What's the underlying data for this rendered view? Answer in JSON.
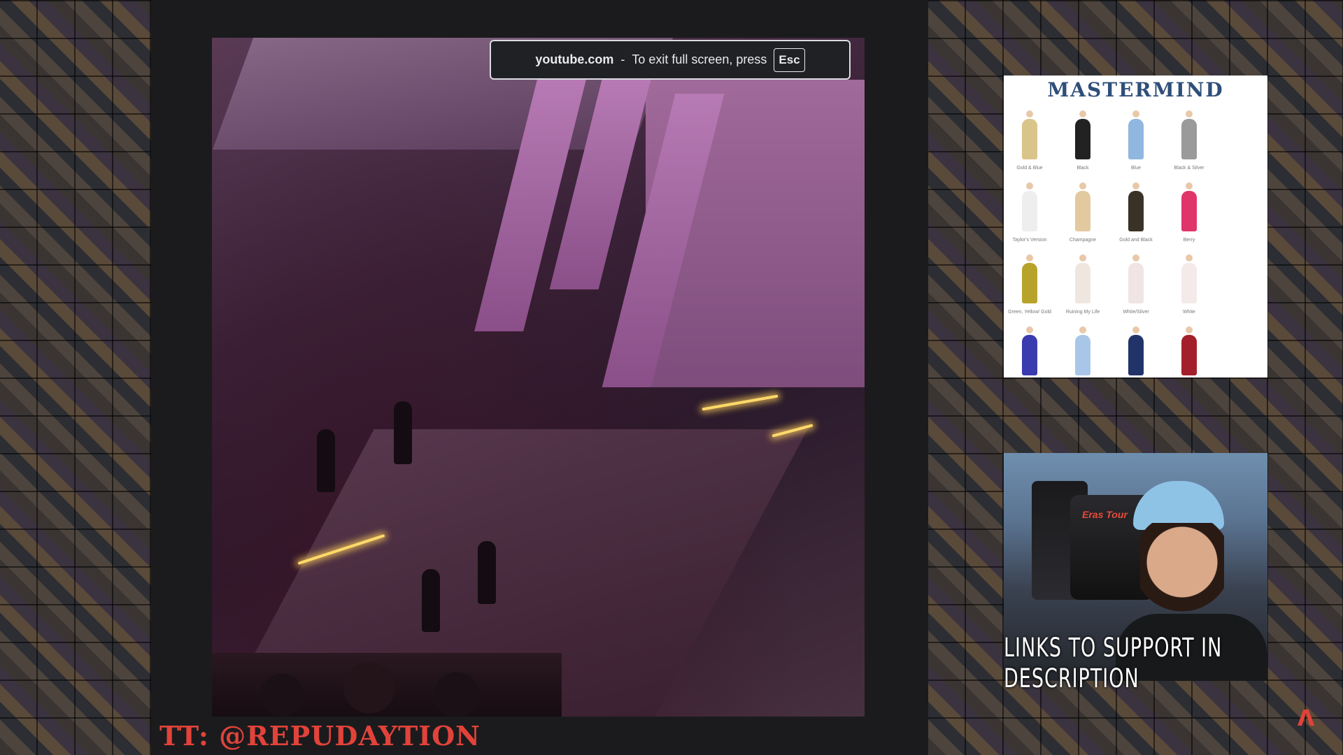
{
  "fullscreen_toast": {
    "domain": "youtube.com",
    "separator": "-",
    "message": "To exit full screen, press",
    "key": "Esc"
  },
  "overlay": {
    "handle": "TT: @REPUDAYTION",
    "support_banner": "LINKS TO SUPPORT IN DESCRIPTION"
  },
  "mastermind": {
    "title": "MASTERMIND",
    "outfits": [
      {
        "label": "Gold & Blue",
        "color": "#d9c48a"
      },
      {
        "label": "Black",
        "color": "#222222"
      },
      {
        "label": "Blue",
        "color": "#8fb7e0"
      },
      {
        "label": "Black & Silver",
        "color": "#9a9a9a"
      },
      {
        "label": "Taylor's Version",
        "color": "#eeeeee"
      },
      {
        "label": "Champagne",
        "color": "#e3c9a0"
      },
      {
        "label": "Gold and Black",
        "color": "#3a3226"
      },
      {
        "label": "Berry",
        "color": "#e0356a"
      },
      {
        "label": "Green, Yellow/ Gold",
        "color": "#b8a32a"
      },
      {
        "label": "Ruining My Life",
        "color": "#f0e6e0"
      },
      {
        "label": "White/Silver",
        "color": "#f1e4e4"
      },
      {
        "label": "White",
        "color": "#f4eaea"
      },
      {
        "label": "",
        "color": "#3b3bb0"
      },
      {
        "label": "",
        "color": "#a8c6e8"
      },
      {
        "label": "",
        "color": "#22336a"
      },
      {
        "label": "",
        "color": "#a3202a"
      }
    ]
  },
  "webcam": {
    "chair_brand": "Eras Tour"
  }
}
